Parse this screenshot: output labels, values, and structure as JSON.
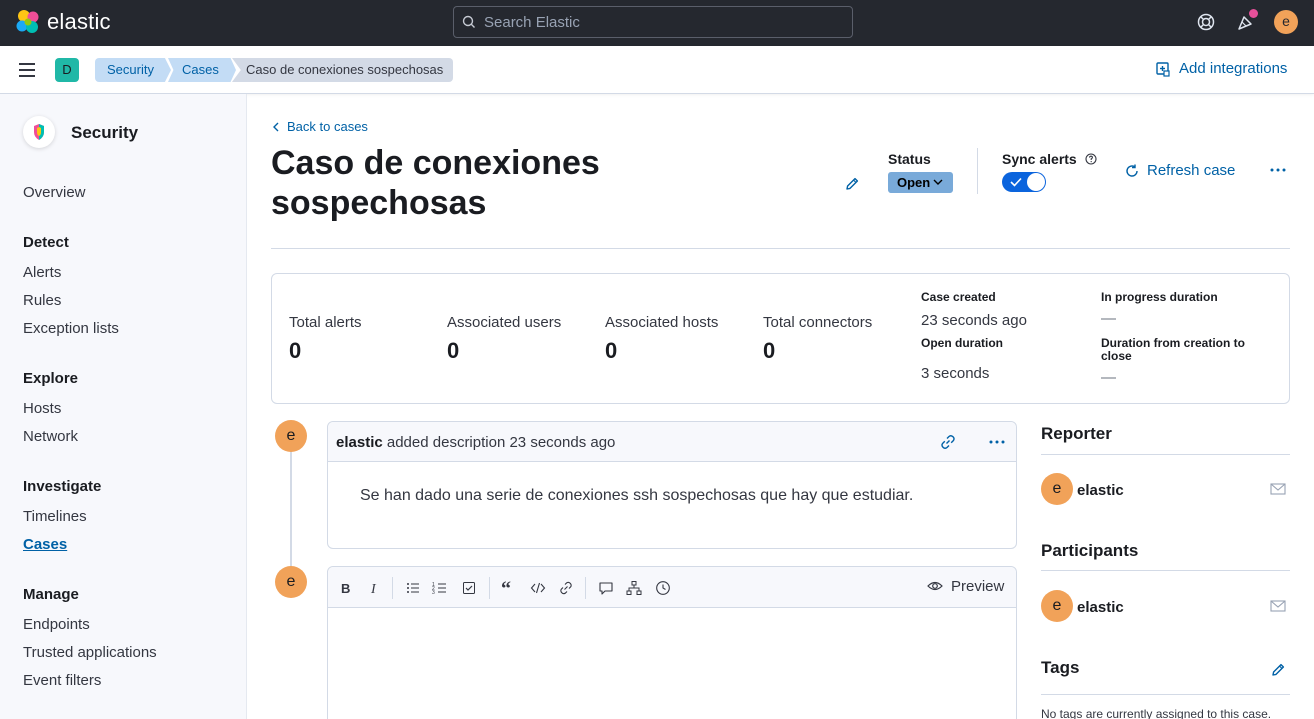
{
  "topbar": {
    "brand": "elastic",
    "search_placeholder": "Search Elastic",
    "user_initial": "e"
  },
  "breadcrumb_bar": {
    "space_initial": "D",
    "crumbs": [
      "Security",
      "Cases",
      "Caso de conexiones sospechosas"
    ],
    "add_integrations": "Add integrations"
  },
  "sidebar": {
    "title": "Security",
    "overview": "Overview",
    "sections": [
      {
        "heading": "Detect",
        "items": [
          "Alerts",
          "Rules",
          "Exception lists"
        ]
      },
      {
        "heading": "Explore",
        "items": [
          "Hosts",
          "Network"
        ]
      },
      {
        "heading": "Investigate",
        "items": [
          "Timelines",
          "Cases"
        ]
      },
      {
        "heading": "Manage",
        "items": [
          "Endpoints",
          "Trusted applications",
          "Event filters"
        ]
      }
    ],
    "active_item": "Cases"
  },
  "header": {
    "back_link": "Back to cases",
    "title": "Caso de conexiones sospechosas",
    "status_label": "Status",
    "status_value": "Open",
    "sync_label": "Sync alerts",
    "sync_enabled": true,
    "refresh": "Refresh case"
  },
  "stats": {
    "items": [
      {
        "label": "Total alerts",
        "value": "0"
      },
      {
        "label": "Associated users",
        "value": "0"
      },
      {
        "label": "Associated hosts",
        "value": "0"
      },
      {
        "label": "Total connectors",
        "value": "0"
      }
    ],
    "case_created_label": "Case created",
    "case_created_value": "23 seconds ago",
    "open_duration_label": "Open duration",
    "open_duration_value": "3 seconds",
    "in_progress_label": "In progress duration",
    "in_progress_value": "—",
    "creation_to_close_label": "Duration from creation to close",
    "creation_to_close_value": "—"
  },
  "activity": {
    "avatar_initial": "e",
    "comment_author": "elastic",
    "comment_action": "added description",
    "comment_time": "23 seconds ago",
    "comment_body": "Se han dado una serie de conexiones ssh sospechosas que hay que estudiar.",
    "editor_preview": "Preview"
  },
  "right_column": {
    "reporter_title": "Reporter",
    "reporter_name": "elastic",
    "participants_title": "Participants",
    "participant_name": "elastic",
    "tags_title": "Tags",
    "tags_empty": "No tags are currently assigned to this case."
  },
  "colors": {
    "topbar_bg": "#25282f",
    "link": "#0061a6",
    "avatar": "#f1a259",
    "toggle_on": "#0b64dd",
    "status_open": "#79aad9"
  }
}
